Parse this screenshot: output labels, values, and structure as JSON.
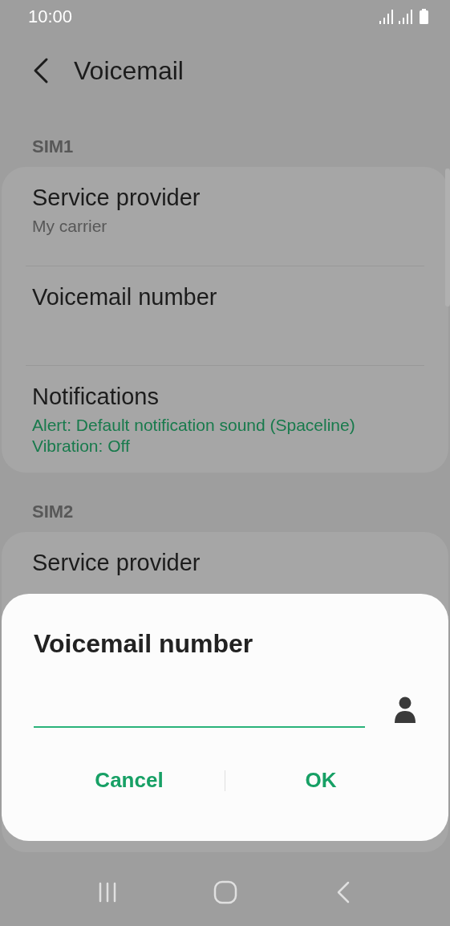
{
  "status_bar": {
    "time": "10:00"
  },
  "header": {
    "title": "Voicemail"
  },
  "sections": [
    {
      "label": "SIM1",
      "items": [
        {
          "title": "Service provider",
          "kind": "plain",
          "lines": [
            "My carrier"
          ]
        },
        {
          "title": "Voicemail number"
        },
        {
          "title": "Notifications",
          "kind": "accent",
          "lines": [
            "Alert: Default notification sound (Spaceline)",
            "Vibration: Off"
          ]
        }
      ]
    },
    {
      "label": "SIM2",
      "items": [
        {
          "title": "Service provider"
        }
      ]
    }
  ],
  "dialog": {
    "title": "Voicemail number",
    "buttons": [
      "Cancel",
      "OK"
    ]
  }
}
